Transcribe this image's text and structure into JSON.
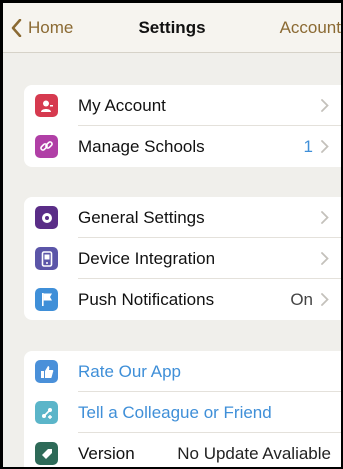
{
  "nav": {
    "back_label": "Home",
    "title": "Settings",
    "right_label": "Account"
  },
  "groups": [
    {
      "rows": [
        {
          "label": "My Account",
          "icon": "user-icon",
          "icon_color": "#d63a4f",
          "value": ""
        },
        {
          "label": "Manage Schools",
          "icon": "link-icon",
          "icon_color": "#b03fa6",
          "value": "1"
        }
      ]
    },
    {
      "rows": [
        {
          "label": "General Settings",
          "icon": "gear-icon",
          "icon_color": "#5a2d87",
          "value": ""
        },
        {
          "label": "Device Integration",
          "icon": "device-icon",
          "icon_color": "#5b55a8",
          "value": ""
        },
        {
          "label": "Push Notifications",
          "icon": "flag-icon",
          "icon_color": "#3f8fd8",
          "value": "On"
        }
      ]
    },
    {
      "rows": [
        {
          "label": "Rate Our App",
          "icon": "thumbs-up-icon",
          "icon_color": "#4a90d9"
        },
        {
          "label": "Tell a Colleague or Friend",
          "icon": "share-icon",
          "icon_color": "#5bb5c9"
        },
        {
          "label": "Version",
          "icon": "tag-icon",
          "icon_color": "#2e6a58",
          "value": "No Update Avaliable"
        }
      ]
    }
  ],
  "colors": {
    "accent": "#8b6a33",
    "link": "#3f8fd8",
    "background": "#f0efeb"
  }
}
